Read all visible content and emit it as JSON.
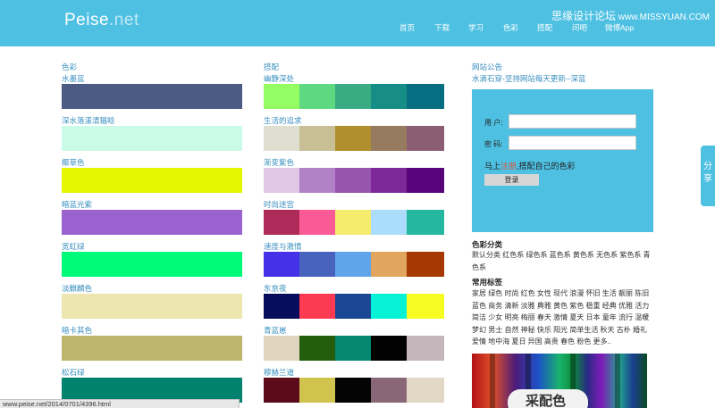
{
  "header": {
    "logo_main": "Peise",
    "logo_suffix": ".net",
    "nav": [
      {
        "label": "首页"
      },
      {
        "label": "下载"
      },
      {
        "label": "学习"
      },
      {
        "label": "色彩"
      },
      {
        "label": "搭配"
      },
      {
        "label": "问吧"
      },
      {
        "label": "微博App"
      }
    ],
    "watermark_cn": "思缘设计论坛",
    "watermark_url": "www.MISSYUAN.COM"
  },
  "colors_section": {
    "title": "色彩",
    "items": [
      {
        "name": "水墨蓝",
        "color": "#4c5b83"
      },
      {
        "name": "深水落漾清猫晗",
        "color": "#c9fbe8"
      },
      {
        "name": "椰草色",
        "color": "#e6f500"
      },
      {
        "name": "暗蓝光紫",
        "color": "#9a63cf"
      },
      {
        "name": "宽虹绿",
        "color": "#00fb7a"
      },
      {
        "name": "淡麒麟色",
        "color": "#ede6b0"
      },
      {
        "name": "暗卡其色",
        "color": "#bcb76c"
      },
      {
        "name": "松石绿",
        "color": "#00826e"
      }
    ]
  },
  "palettes_section": {
    "title": "搭配",
    "items": [
      {
        "name": "幽静深处",
        "colors": [
          "#93fd63",
          "#5ed881",
          "#3aab82",
          "#168d86",
          "#076d80"
        ]
      },
      {
        "name": "生活的追求",
        "colors": [
          "#dedfd1",
          "#c9bf97",
          "#af8f2e",
          "#977b60",
          "#8c5e74"
        ]
      },
      {
        "name": "渐变紫色",
        "colors": [
          "#dfc8e7",
          "#b282c6",
          "#9654ad",
          "#7d2899",
          "#57037a"
        ]
      },
      {
        "name": "时尚迷宫",
        "colors": [
          "#ae2a58",
          "#fa5a96",
          "#f5ec6e",
          "#abdcfb",
          "#26b7a0"
        ]
      },
      {
        "name": "速度与激情",
        "colors": [
          "#4532e8",
          "#4863be",
          "#60a5e9",
          "#e2a55d",
          "#a63804"
        ]
      },
      {
        "name": "东京夜",
        "colors": [
          "#070d5c",
          "#fc3a52",
          "#1b4693",
          "#05f2d6",
          "#f6fb22"
        ]
      },
      {
        "name": "青蓝崽",
        "colors": [
          "#e0d4bf",
          "#245e0c",
          "#058870",
          "#020203",
          "#c5b6bc"
        ]
      },
      {
        "name": "穆赫兰道",
        "colors": [
          "#5c0b1b",
          "#d0c44f",
          "#040404",
          "#8a6776",
          "#e1d9c6"
        ]
      }
    ]
  },
  "announcement": {
    "title": "网站公告",
    "text": "水滴石穿-坚持网站每天更新--深蓝"
  },
  "login": {
    "user_label": "用 户:",
    "pass_label": "密 码:",
    "promo_before": "马上",
    "promo_register": "注册",
    "promo_after": ",搭配自己的色彩",
    "button": "登录"
  },
  "categories": {
    "title": "色彩分类",
    "text": "默认分类 红色系 绿色系 蓝色系 黄色系 无色系 紫色系 青色系"
  },
  "tags": {
    "title": "常用标签",
    "text": "家居 绿色 时尚 红色 女性 现代 浪漫 怀旧 生活 靓丽 陈旧 蓝色 商务 清新 淡雅 典雅 黄色 紫色 稳重 经典 优雅 活力 简洁 少女 明亮 梅丽 春天 激情 夏天 日本 童年 流行 温暖 梦幻 男士 自然 神秘 快乐 阳光 简单生活 秋天 古朴 婚礼 爱情 地中海 夏日 异国 高贵 春色 粉色 更多.."
  },
  "banner": {
    "text": "采配色"
  },
  "side_tab": {
    "text": "分享"
  },
  "statusbar": {
    "url": "www.peise.net/2014/0701/4396.html"
  },
  "accent_color": "#4ec0e2"
}
